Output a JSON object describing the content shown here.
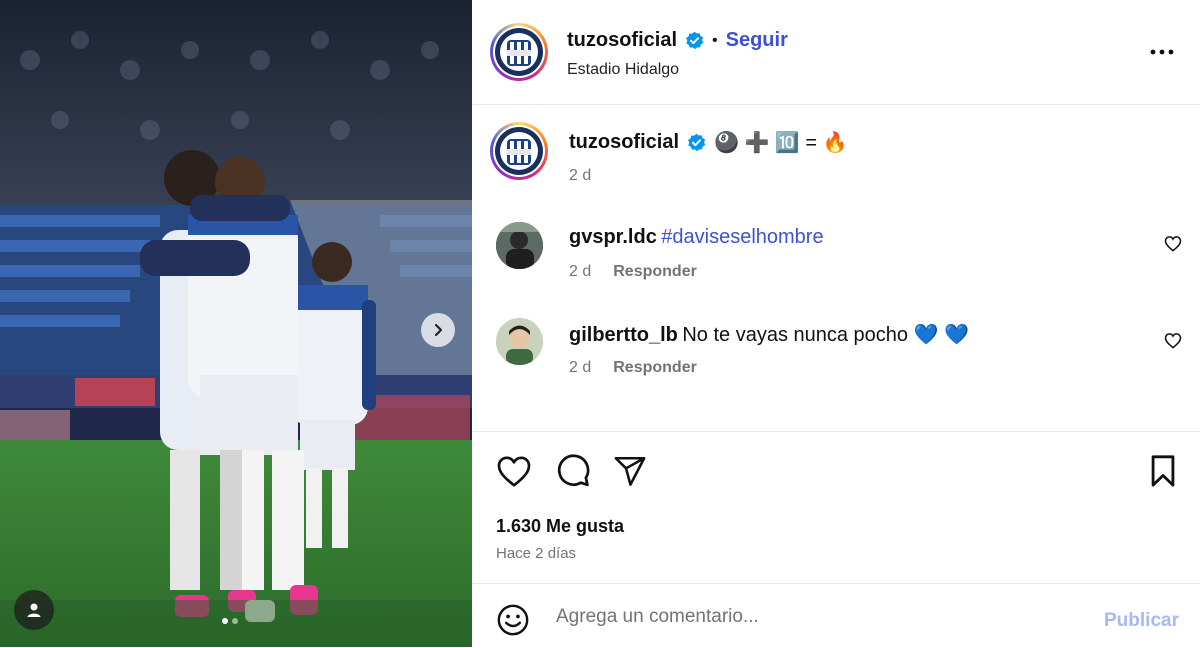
{
  "post": {
    "author": "tuzosoficial",
    "follow_label": "Seguir",
    "separator": "•",
    "location": "Estadio Hidalgo",
    "more_label": "•••"
  },
  "caption": {
    "author": "tuzosoficial",
    "text": "🎱 ➕ 🔟 = 🔥",
    "time": "2 d"
  },
  "comments": [
    {
      "user": "gvspr.ldc",
      "text": "",
      "hashtag": "#daviseselhombre",
      "time": "2 d",
      "reply_label": "Responder"
    },
    {
      "user": "gilbertto_lb",
      "text": "No te vayas nunca pocho 💙 💙",
      "hashtag": "",
      "time": "2 d",
      "reply_label": "Responder"
    }
  ],
  "stats": {
    "likes": "1.630 Me gusta",
    "date": "Hace 2 días"
  },
  "comment_box": {
    "placeholder": "Agrega un comentario...",
    "publish_label": "Publicar"
  },
  "colors": {
    "link_blue": "#3e4fd8",
    "verified_blue": "#0095f6",
    "muted": "#737373",
    "publish_disabled": "#a6b8f5"
  },
  "carousel": {
    "total": 2,
    "current": 1
  },
  "icons": [
    "verified-icon",
    "more-icon",
    "heart-icon",
    "comment-icon",
    "share-icon",
    "bookmark-icon",
    "emoji-icon",
    "chevron-right-icon",
    "user-tag-icon"
  ]
}
